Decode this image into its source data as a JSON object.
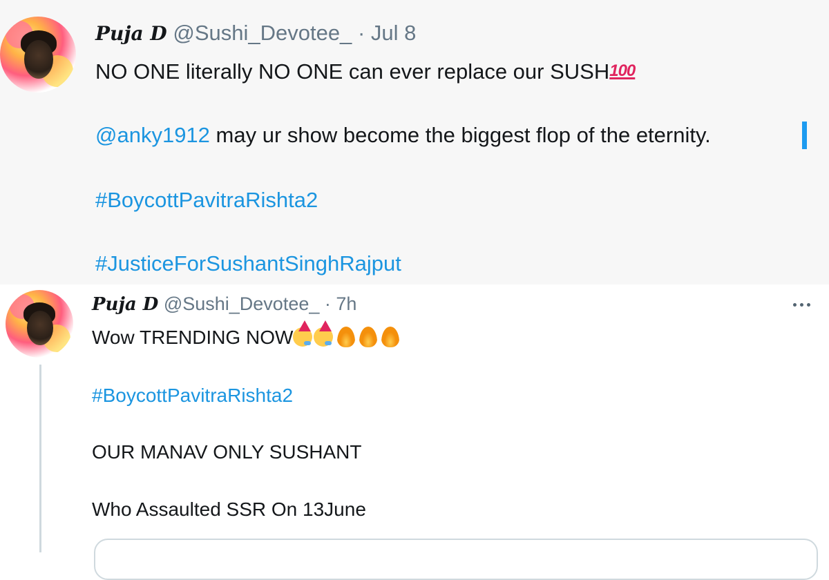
{
  "tweets": [
    {
      "name": "Puja D",
      "handle": "@Sushi_Devotee_",
      "separator": "·",
      "time": "Jul 8",
      "line1": "NO ONE literally NO ONE can ever replace our SUSH",
      "line1_emoji": "100",
      "mention": "@anky1912",
      "line2_rest": " may ur show become the biggest flop of the eternity.",
      "hashtag1": "#BoycottPavitraRishta2",
      "hashtag2": "#JusticeForSushantSinghRajput"
    },
    {
      "name": "Puja D",
      "handle": "@Sushi_Devotee_",
      "separator": "·",
      "time": "7h",
      "line1": "Wow TRENDING NOW",
      "line1_emojis": [
        "party-face",
        "party-face",
        "fire",
        "fire",
        "fire"
      ],
      "hashtag1": "#BoycottPavitraRishta2",
      "line2": "OUR MANAV ONLY SUSHANT",
      "line3": "Who Assaulted SSR On 13June"
    }
  ],
  "icons": {
    "more": "more-horizontal-icon"
  },
  "colors": {
    "link": "#1b95e0",
    "handle": "#657786",
    "top_background": "#f7f7f7",
    "thread_line": "#cfd9de"
  }
}
